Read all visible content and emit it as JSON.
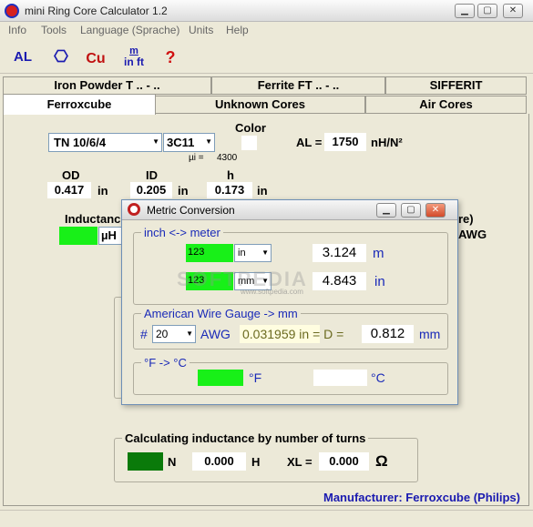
{
  "window": {
    "title": "mini Ring Core Calculator 1.2"
  },
  "menu": [
    "Info",
    "Tools",
    "Language (Sprache)",
    "Units",
    "Help"
  ],
  "toolbar": {
    "btn1": "AL",
    "btn3": "Cu",
    "btn4_top": "m",
    "btn4_bottom": "in ft",
    "btn5": "?"
  },
  "tabs_row1": [
    "Iron Powder T .. - ..",
    "Ferrite FT .. - ..",
    "SIFFERIT"
  ],
  "tabs_row2": [
    "Ferroxcube",
    "Unknown Cores",
    "Air Cores"
  ],
  "core": {
    "type_value": "TN 10/6/4",
    "material_value": "3C11",
    "color_label": "Color",
    "mu_label": "µi =",
    "mu_value": "4300",
    "al_label": "AL =",
    "al_value": "1750",
    "al_unit": "nH/N²",
    "od_label": "OD",
    "od_value": "0.417",
    "od_unit": "in",
    "id_label": "ID",
    "id_value": "0.205",
    "id_unit": "in",
    "h_label": "h",
    "h_value": "0.173",
    "h_unit": "in",
    "inductance_label": "Inductanc",
    "inductance_unit": "µH",
    "right_partial1": "re)",
    "right_partial2": "AWG"
  },
  "turns": {
    "title": "Calculating inductance by number of turns",
    "n_label": "N",
    "h_value": "0.000",
    "h_unit": "H",
    "xl_label": "XL =",
    "xl_value": "0.000",
    "xl_unit": "Ω"
  },
  "manufacturer": "Manufacturer: Ferroxcube (Philips)",
  "popup": {
    "title": "Metric Conversion",
    "inch_meter_title": "inch <-> meter",
    "row1_input": "123",
    "row1_unit": "in",
    "row1_result": "3.124",
    "row1_result_unit": "m",
    "row2_input": "123",
    "row2_unit": "mm",
    "row2_result": "4.843",
    "row2_result_unit": "in",
    "awg_title": "American Wire Gauge -> mm",
    "awg_hash": "#",
    "awg_value": "20",
    "awg_label": "AWG",
    "awg_inch": "0.031959 in = D =",
    "awg_result": "0.812",
    "awg_unit": "mm",
    "temp_title": "°F -> °C",
    "f_unit": "°F",
    "c_unit": "°C"
  },
  "watermark": "SOFTPEDIA",
  "watermark_small": "www.softpedia.com"
}
